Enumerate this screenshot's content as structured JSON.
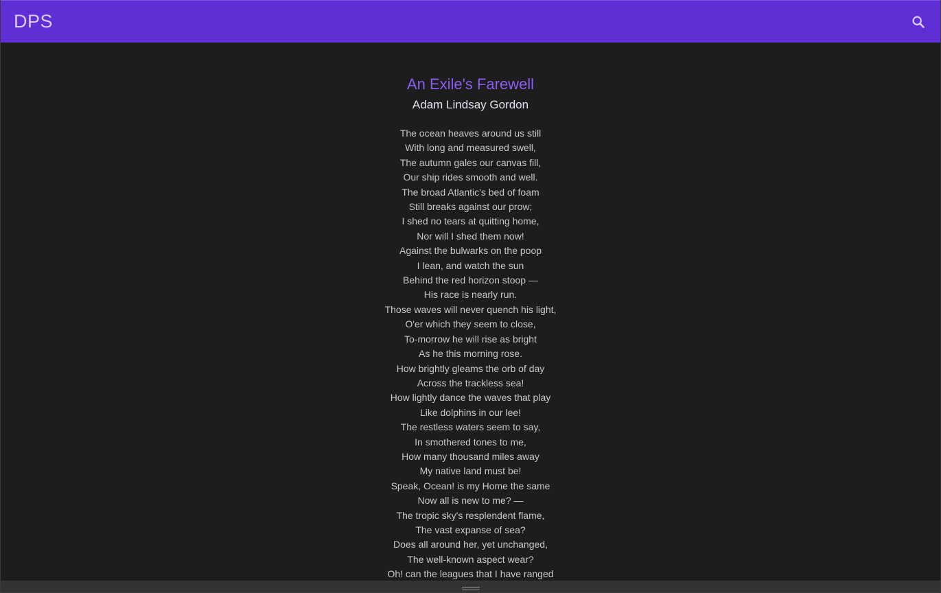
{
  "app": {
    "title": "DPS",
    "search_icon": "search-icon",
    "accent_color": "#5f2ed4"
  },
  "poem": {
    "title": "An Exile's Farewell",
    "author": "Adam Lindsay Gordon",
    "lines": [
      "The ocean heaves around us still",
      "With long and measured swell,",
      "The autumn gales our canvas fill,",
      "Our ship rides smooth and well.",
      "The broad Atlantic's bed of foam",
      "Still breaks against our prow;",
      "I shed no tears at quitting home,",
      "Nor will I shed them now!",
      "Against the bulwarks on the poop",
      "I lean, and watch the sun",
      "Behind the red horizon stoop —",
      "His race is nearly run.",
      "Those waves will never quench his light,",
      "O'er which they seem to close,",
      "To-morrow he will rise as bright",
      "As he this morning rose.",
      "How brightly gleams the orb of day",
      "Across the trackless sea!",
      "How lightly dance the waves that play",
      "Like dolphins in our lee!",
      "The restless waters seem to say,",
      "In smothered tones to me,",
      "How many thousand miles away",
      "My native land must be!",
      "Speak, Ocean! is my Home the same",
      "Now all is new to me? —",
      "The tropic sky's resplendent flame,",
      "The vast expanse of sea?",
      "Does all around her, yet unchanged,",
      "The well-known aspect wear?",
      "Oh! can the leagues that I have ranged"
    ]
  }
}
